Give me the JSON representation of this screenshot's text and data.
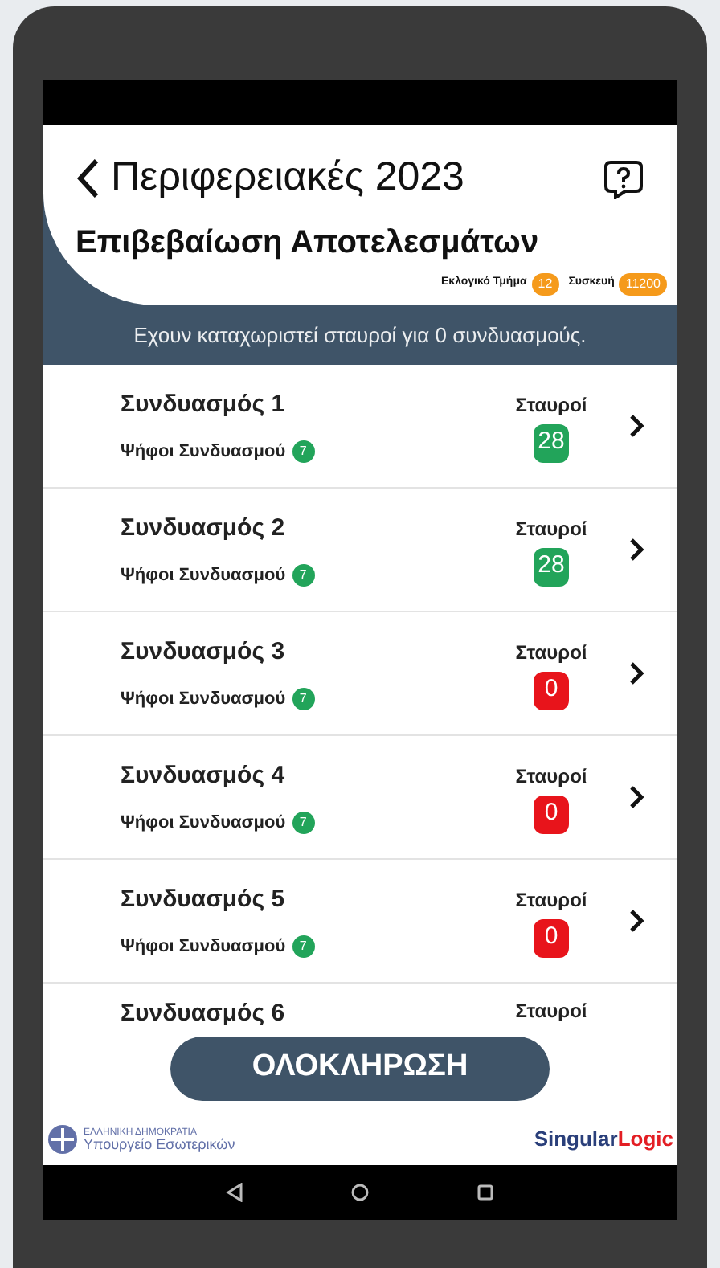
{
  "header": {
    "title": "Περιφερειακές 2023",
    "subtitle": "Επιβεβαίωση Αποτελεσμάτων",
    "badges": [
      {
        "label": "Εκλογικό Τμήμα",
        "value": "12"
      },
      {
        "label": "Συσκευή",
        "value": "11200"
      }
    ]
  },
  "banner": "Εχουν καταχωριστεί σταυροί για 0 συνδυασμούς.",
  "rows": [
    {
      "name": "Συνδυασμός 1",
      "votes_label": "Ψήφοι Συνδυασμού",
      "votes": "7",
      "crosses_label": "Σταυροί",
      "crosses": "28",
      "color": "#22a45a"
    },
    {
      "name": "Συνδυασμός 2",
      "votes_label": "Ψήφοι Συνδυασμού",
      "votes": "7",
      "crosses_label": "Σταυροί",
      "crosses": "28",
      "color": "#22a45a"
    },
    {
      "name": "Συνδυασμός 3",
      "votes_label": "Ψήφοι Συνδυασμού",
      "votes": "7",
      "crosses_label": "Σταυροί",
      "crosses": "0",
      "color": "#e8141b"
    },
    {
      "name": "Συνδυασμός 4",
      "votes_label": "Ψήφοι Συνδυασμού",
      "votes": "7",
      "crosses_label": "Σταυροί",
      "crosses": "0",
      "color": "#e8141b"
    },
    {
      "name": "Συνδυασμός 5",
      "votes_label": "Ψήφοι Συνδυασμού",
      "votes": "7",
      "crosses_label": "Σταυροί",
      "crosses": "0",
      "color": "#e8141b"
    },
    {
      "name": "Συνδυασμός 6",
      "crosses_label": "Σταυροί"
    }
  ],
  "complete_button": "ΟΛΟΚΛΗΡΩΣΗ",
  "footer": {
    "ministry_line_1": "ΕΛΛΗΝΙΚΗ ΔΗΜΟΚΡΑΤΙΑ",
    "ministry_line_2": "Υπουργείο Εσωτερικών",
    "brand_part_1": "Singular",
    "brand_part_2": "Logic"
  }
}
